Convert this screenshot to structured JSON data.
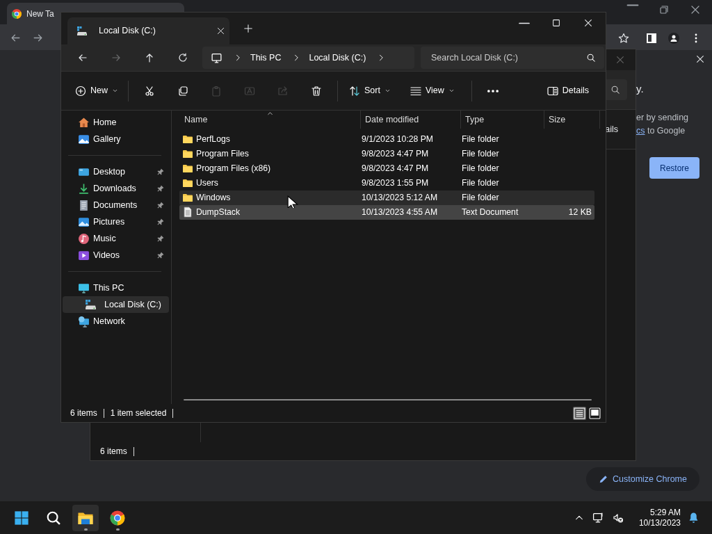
{
  "browser": {
    "tab": {
      "title": "New Ta"
    },
    "side_panel": {
      "heading_end": "y.",
      "line_1": "er by sending",
      "link": "cs",
      "line_2_rest": " to Google",
      "restore_button": "Restore"
    },
    "customize_button": "Customize Chrome"
  },
  "background_explorer": {
    "details_button": "ails",
    "status": "6 items"
  },
  "explorer": {
    "tab": {
      "title": "Local Disk (C:)"
    },
    "nav_buttons": [
      {
        "kind": "back",
        "disabled": false
      },
      {
        "kind": "forward",
        "disabled": true
      },
      {
        "kind": "up",
        "disabled": false
      },
      {
        "kind": "refresh",
        "disabled": false
      }
    ],
    "breadcrumb": [
      "This PC",
      "Local Disk (C:)"
    ],
    "search": {
      "placeholder": "Search Local Disk (C:)"
    },
    "toolbar": [
      [
        {
          "kind": "new",
          "label": "New",
          "disabled": false
        }
      ],
      [
        {
          "kind": "cut",
          "disabled": false
        },
        {
          "kind": "copy",
          "disabled": false
        },
        {
          "kind": "paste",
          "disabled": true
        },
        {
          "kind": "rename",
          "disabled": true
        },
        {
          "kind": "share",
          "disabled": true
        },
        {
          "kind": "delete",
          "disabled": false
        }
      ],
      [
        {
          "kind": "sort",
          "label": "Sort",
          "disabled": false
        },
        {
          "kind": "view",
          "label": "View",
          "disabled": false
        }
      ],
      [
        {
          "kind": "more",
          "disabled": false
        }
      ]
    ],
    "details_button": "Details",
    "sidebar": [
      [
        {
          "kind": "home",
          "label": "Home",
          "pinned": false,
          "selected": false
        },
        {
          "kind": "gallery",
          "label": "Gallery",
          "pinned": false,
          "selected": false
        }
      ],
      [
        {
          "kind": "desktop",
          "label": "Desktop",
          "pinned": true,
          "selected": false
        },
        {
          "kind": "downloads",
          "label": "Downloads",
          "pinned": true,
          "selected": false
        },
        {
          "kind": "documents",
          "label": "Documents",
          "pinned": true,
          "selected": false
        },
        {
          "kind": "pictures",
          "label": "Pictures",
          "pinned": true,
          "selected": false
        },
        {
          "kind": "music",
          "label": "Music",
          "pinned": true,
          "selected": false
        },
        {
          "kind": "videos",
          "label": "Videos",
          "pinned": true,
          "selected": false
        }
      ],
      [
        {
          "kind": "pc",
          "label": "This PC",
          "pinned": false,
          "selected": false,
          "children": [
            {
              "kind": "disk",
              "label": "Local Disk (C:)",
              "pinned": false,
              "selected": true
            }
          ]
        },
        {
          "kind": "network",
          "label": "Network",
          "pinned": false,
          "selected": false
        }
      ]
    ],
    "columns": [
      "Name",
      "Date modified",
      "Type",
      "Size"
    ],
    "rows": [
      {
        "kind": "folder",
        "name": "PerfLogs",
        "date": "9/1/2023 10:28 PM",
        "type": "File folder",
        "selected": false,
        "hovered": false
      },
      {
        "kind": "folder",
        "name": "Program Files",
        "date": "9/8/2023 4:47 PM",
        "type": "File folder",
        "selected": false,
        "hovered": false
      },
      {
        "kind": "folder",
        "name": "Program Files (x86)",
        "date": "9/8/2023 4:47 PM",
        "type": "File folder",
        "selected": false,
        "hovered": false
      },
      {
        "kind": "folder",
        "name": "Users",
        "date": "9/8/2023 1:55 PM",
        "type": "File folder",
        "selected": false,
        "hovered": false
      },
      {
        "kind": "folder",
        "name": "Windows",
        "date": "10/13/2023 5:12 AM",
        "type": "File folder",
        "selected": false,
        "hovered": true
      },
      {
        "kind": "text",
        "name": "DumpStack",
        "date": "10/13/2023 4:55 AM",
        "type": "Text Document",
        "size": "12 KB",
        "selected": true,
        "hovered": false
      }
    ],
    "status": {
      "count": "6 items",
      "selection": "1 item selected"
    },
    "view_modes": [
      {
        "kind": "details",
        "selected": true
      },
      {
        "kind": "tiles",
        "selected": false
      }
    ]
  },
  "taskbar": {
    "apps": [
      {
        "kind": "start",
        "selected": false,
        "running": false
      },
      {
        "kind": "search",
        "selected": false,
        "running": false
      },
      {
        "kind": "explorer",
        "selected": true,
        "running": true
      },
      {
        "kind": "chrome",
        "selected": false,
        "running": true
      }
    ],
    "time": "5:29 AM",
    "date": "10/13/2023"
  }
}
